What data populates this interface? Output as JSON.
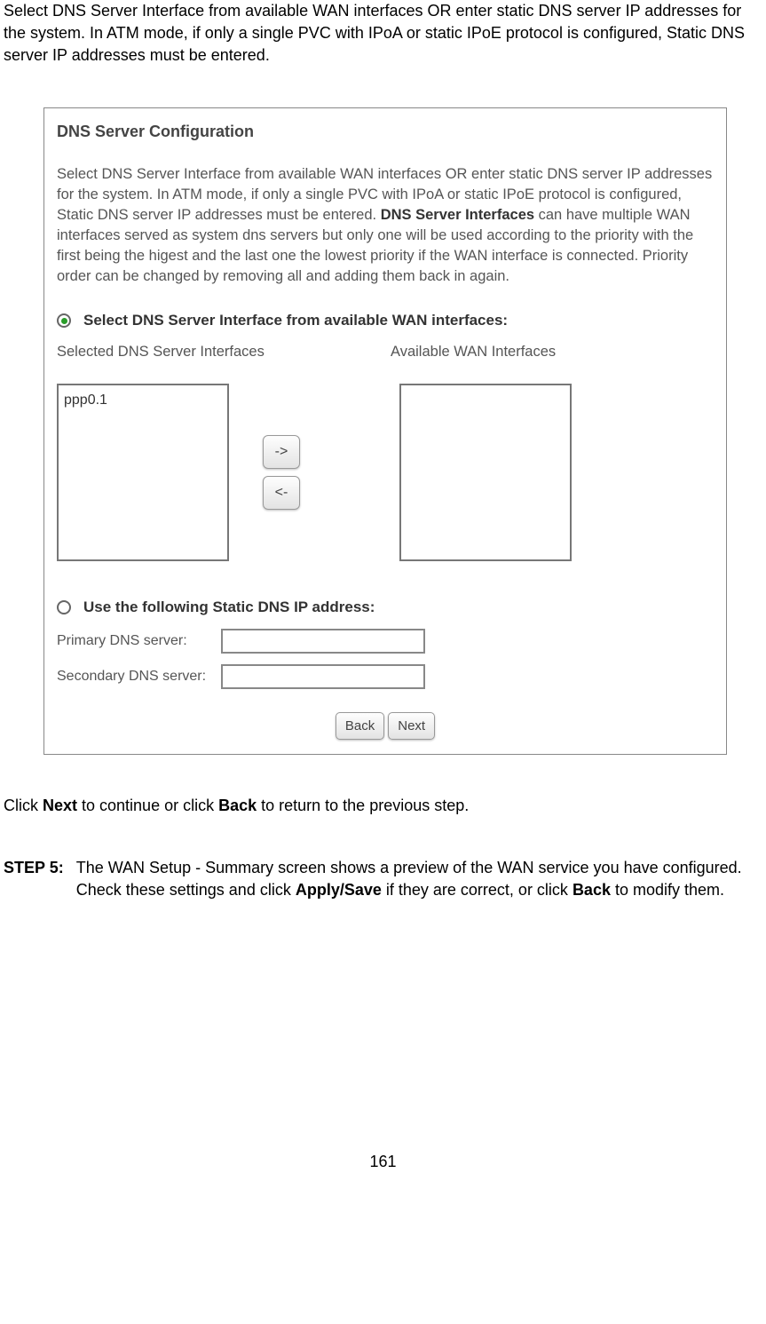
{
  "intro": "Select DNS Server Interface from available WAN interfaces OR enter static DNS server IP addresses for the system. In ATM mode, if only a single PVC with IPoA or static IPoE protocol is configured, Static DNS server IP addresses must be entered.",
  "panel": {
    "title": "DNS Server Configuration",
    "desc_part1": "Select DNS Server Interface from available WAN interfaces OR enter static DNS server IP addresses for the system. In ATM mode, if only a single PVC with IPoA or static IPoE protocol is configured, Static DNS server IP addresses must be entered. ",
    "desc_bold": "DNS Server Interfaces",
    "desc_part2": " can have multiple WAN interfaces served as system dns servers but only one will be used according to the priority with the first being the higest and the last one the lowest priority if the WAN interface is connected. Priority order can be changed by removing all and adding them back in again.",
    "radio1_label": "Select DNS Server Interface from available WAN interfaces:",
    "selected_label": "Selected DNS Server Interfaces",
    "available_label": "Available WAN Interfaces",
    "selected_items": [
      "ppp0.1"
    ],
    "btn_right": "->",
    "btn_left": "<-",
    "radio2_label": "Use the following Static DNS IP address:",
    "primary_label": "Primary DNS server:",
    "secondary_label": "Secondary DNS server:",
    "back_btn": "Back",
    "next_btn": "Next"
  },
  "click_next": {
    "pre": "Click ",
    "next": "Next",
    "mid": " to continue or click ",
    "back": "Back",
    "post": " to return to the previous step."
  },
  "step5": {
    "label": "STEP 5:",
    "pre": "The WAN Setup - Summary screen shows a preview of the WAN service you have configured. Check these settings and click ",
    "apply": "Apply/Save",
    "mid": " if they are correct, or click ",
    "back": "Back",
    "post": " to modify them."
  },
  "page_number": "161"
}
